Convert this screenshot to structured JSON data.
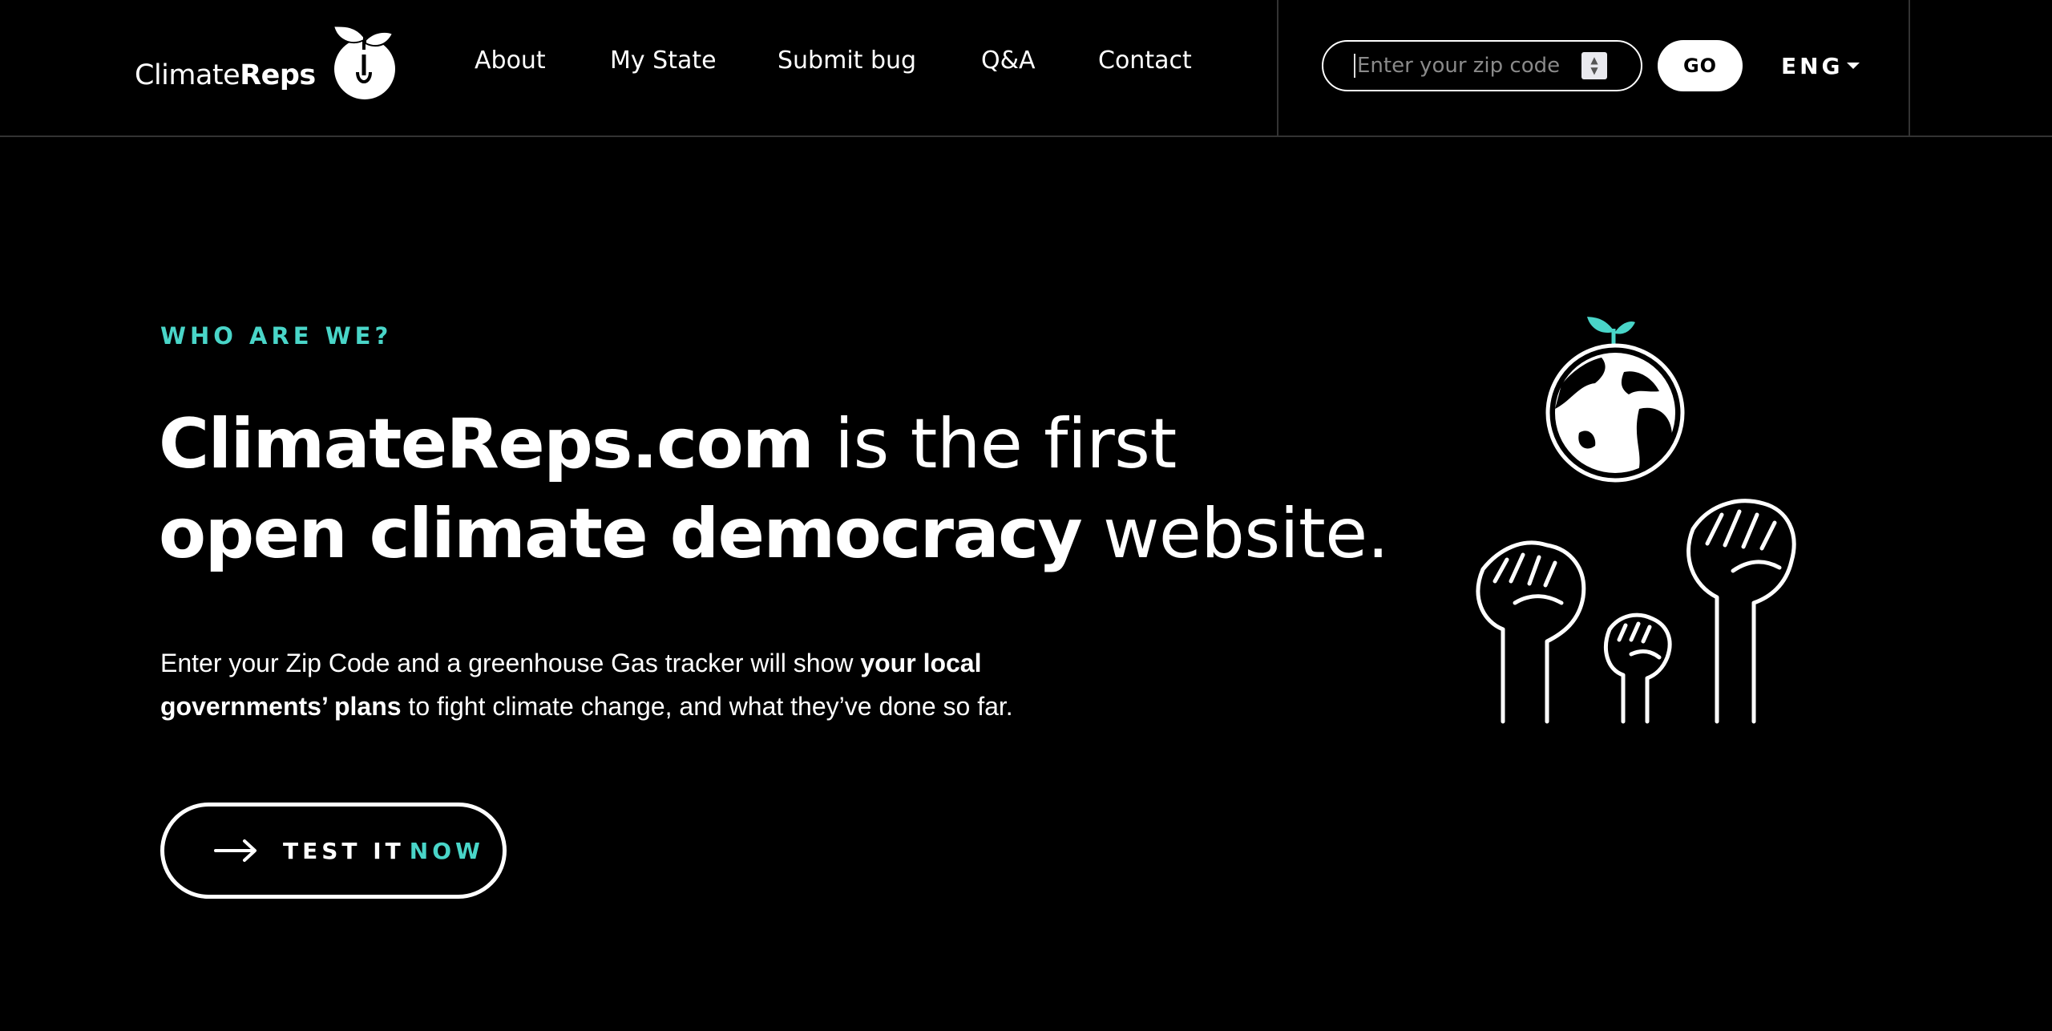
{
  "logo": {
    "prefix": "Climate",
    "suffix": "Reps"
  },
  "nav": {
    "items": [
      {
        "label": "About"
      },
      {
        "label": "My State"
      },
      {
        "label": "Submit bug"
      },
      {
        "label": "Q&A"
      },
      {
        "label": "Contact"
      }
    ]
  },
  "search": {
    "placeholder": "Enter your zip code",
    "value": "",
    "go_label": "GO"
  },
  "language": {
    "label": "ENG"
  },
  "hero": {
    "eyebrow": "WHO ARE WE?",
    "headline": {
      "line1_bold": "ClimateReps.com",
      "line1_rest": " is the first",
      "line2_bold": "open climate democracy",
      "line2_rest": " website."
    },
    "description": {
      "part1": "Enter your Zip Code and a greenhouse Gas tracker will show ",
      "bold1": "your local",
      "bold2": "governments’ plans",
      "part2": " to fight climate change, and what they’ve done so far."
    },
    "cta": {
      "label": "TEST IT",
      "accent": "NOW"
    }
  },
  "colors": {
    "accent": "#49d5c8",
    "background": "#000000",
    "text": "#ffffff"
  },
  "icons": [
    "apple-seedling-logo-icon",
    "spinner-arrows-icon",
    "caret-down-icon",
    "arrow-right-icon",
    "globe-sprout-icon",
    "raised-fists-icon"
  ]
}
